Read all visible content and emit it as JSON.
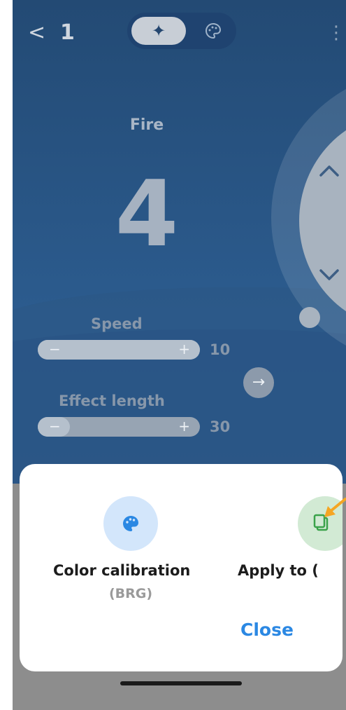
{
  "header": {
    "back_icon": "chevron-left-icon",
    "back_glyph": "<",
    "device_number": "1",
    "mode_active_icon": "sparkle-icon",
    "mode_active_glyph": "✦",
    "mode_inactive_icon": "palette-icon",
    "mode_inactive_glyph": "☺",
    "menu_icon": "more-vertical-icon",
    "menu_glyph": "⋮"
  },
  "effect": {
    "name": "Fire",
    "number": "4"
  },
  "dial": {
    "up_icon": "chevron-up-icon",
    "down_icon": "chevron-down-icon"
  },
  "sliders": [
    {
      "label": "Speed",
      "value": "10",
      "minus": "−",
      "plus": "+",
      "fill_fraction": 1.0
    },
    {
      "label": "Effect length",
      "value": "30",
      "minus": "−",
      "plus": "+",
      "fill_fraction": 0.2
    }
  ],
  "next_button_icon": "arrow-right-icon",
  "next_glyph": "→",
  "bottom_sheet": {
    "options": [
      {
        "icon": "palette-icon",
        "title": "Color calibration",
        "subtitle": "(BRG)"
      },
      {
        "icon": "copy-icon",
        "title": "Apply to ("
      }
    ],
    "close_label": "Close"
  },
  "colors": {
    "accent": "#2b88e3",
    "background": "#2a5889",
    "sheet": "#ffffff",
    "pointer_arrow": "#f5a623"
  }
}
